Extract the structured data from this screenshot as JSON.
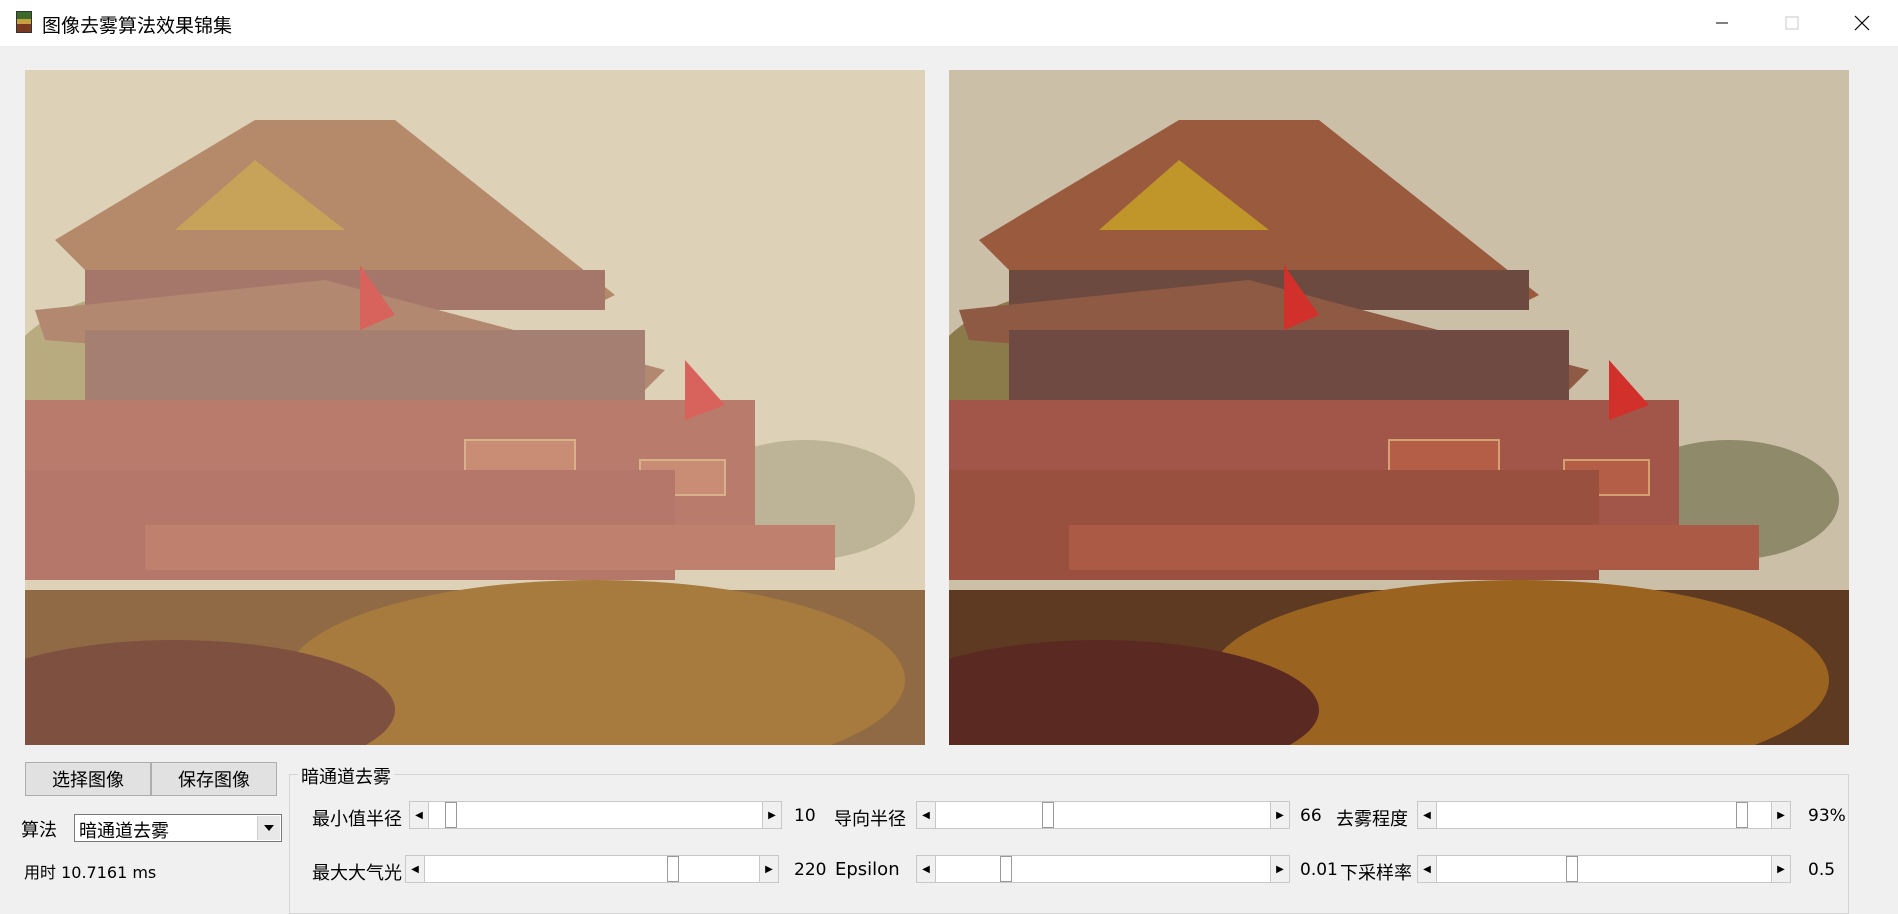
{
  "window": {
    "title": "图像去雾算法效果锦集",
    "minimize_icon": "minimize-icon",
    "maximize_icon": "maximize-icon",
    "close_icon": "close-icon"
  },
  "images": {
    "left": "hazy-input-image",
    "right": "dehazed-output-image"
  },
  "buttons": {
    "select": "选择图像",
    "save": "保存图像"
  },
  "algorithm": {
    "label": "算法",
    "selected": "暗通道去雾"
  },
  "timing": "用时 10.7161 ms",
  "group": {
    "title": "暗通道去雾",
    "sliders": [
      {
        "label": "最小值半径",
        "value_text": "10",
        "level": 0.05
      },
      {
        "label": "导向半径",
        "value_text": "66",
        "level": 0.33
      },
      {
        "label": "去雾程度",
        "value_text": "93%",
        "level": 0.93
      },
      {
        "label": "最大大气光",
        "value_text": "220",
        "level": 0.75
      },
      {
        "label": "Epsilon",
        "value_text": "0.01",
        "level": 0.2
      },
      {
        "label": "下采样率",
        "value_text": "0.5",
        "level": 0.4
      }
    ]
  }
}
